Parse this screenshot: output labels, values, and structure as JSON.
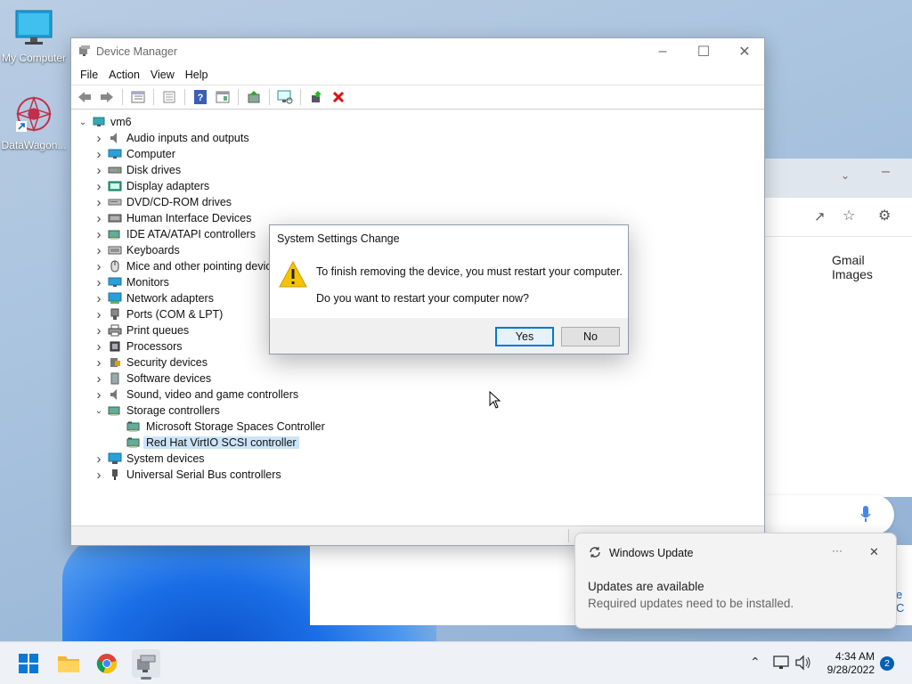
{
  "desktop": {
    "icons": [
      {
        "label": "My Computer",
        "icon": "monitor-icon"
      },
      {
        "label": "DataWagon...",
        "icon": "datawagon-shortcut-icon"
      }
    ]
  },
  "chrome": {
    "links": [
      "Gmail",
      "Images"
    ],
    "partial_text": "e C"
  },
  "device_manager": {
    "title": "Device Manager",
    "menu": [
      "File",
      "Action",
      "View",
      "Help"
    ],
    "toolbar": [
      "back-icon",
      "forward-icon",
      "properties-grid-icon",
      "show-hidden-icon",
      "help-icon",
      "properties-icon",
      "update-driver-icon",
      "scan-hardware-icon",
      "enable-device-icon",
      "uninstall-device-icon"
    ],
    "root": "vm6",
    "categories": [
      {
        "label": "Audio inputs and outputs",
        "icon": "speaker-icon"
      },
      {
        "label": "Computer",
        "icon": "computer-icon"
      },
      {
        "label": "Disk drives",
        "icon": "disk-drive-icon"
      },
      {
        "label": "Display adapters",
        "icon": "display-adapter-icon"
      },
      {
        "label": "DVD/CD-ROM drives",
        "icon": "dvd-drive-icon"
      },
      {
        "label": "Human Interface Devices",
        "icon": "hid-icon"
      },
      {
        "label": "IDE ATA/ATAPI controllers",
        "icon": "ide-controller-icon"
      },
      {
        "label": "Keyboards",
        "icon": "keyboard-icon"
      },
      {
        "label": "Mice and other pointing devices",
        "icon": "mouse-icon"
      },
      {
        "label": "Monitors",
        "icon": "monitor-icon"
      },
      {
        "label": "Network adapters",
        "icon": "network-adapter-icon"
      },
      {
        "label": "Ports (COM & LPT)",
        "icon": "port-icon"
      },
      {
        "label": "Print queues",
        "icon": "printer-icon"
      },
      {
        "label": "Processors",
        "icon": "processor-icon"
      },
      {
        "label": "Security devices",
        "icon": "security-device-icon"
      },
      {
        "label": "Software devices",
        "icon": "software-device-icon"
      },
      {
        "label": "Sound, video and game controllers",
        "icon": "sound-controller-icon"
      },
      {
        "label": "Storage controllers",
        "icon": "storage-controller-icon",
        "expanded": true,
        "children": [
          "Microsoft Storage Spaces Controller",
          "Red Hat VirtIO SCSI controller"
        ]
      },
      {
        "label": "System devices",
        "icon": "system-device-icon"
      },
      {
        "label": "Universal Serial Bus controllers",
        "icon": "usb-icon"
      }
    ],
    "selected": "Red Hat VirtIO SCSI controller"
  },
  "dialog": {
    "title": "System Settings Change",
    "message": "To finish removing the device, you must restart your computer.",
    "question": "Do you want to restart your computer now?",
    "yes_label": "Yes",
    "no_label": "No"
  },
  "toast": {
    "app": "Windows Update",
    "title": "Updates are available",
    "body": "Required updates need to be installed.",
    "more": "···"
  },
  "taskbar": {
    "time": "4:34 AM",
    "date": "9/28/2022",
    "notification_count": "2"
  }
}
